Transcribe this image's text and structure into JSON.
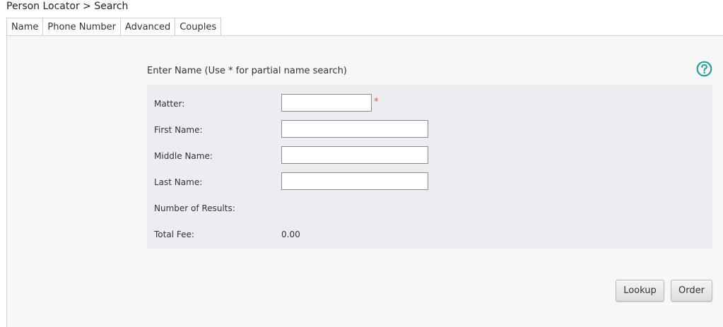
{
  "breadcrumb": "Person Locator > Search",
  "tabs": [
    {
      "label": "Name",
      "active": true
    },
    {
      "label": "Phone Number",
      "active": false
    },
    {
      "label": "Advanced",
      "active": false
    },
    {
      "label": "Couples",
      "active": false
    }
  ],
  "section": {
    "title": "Enter Name (Use * for partial name search)",
    "help_icon": "question-circle-icon"
  },
  "form": {
    "matter": {
      "label": "Matter:",
      "value": "",
      "required_marker": "*"
    },
    "first_name": {
      "label": "First Name:",
      "value": ""
    },
    "middle_name": {
      "label": "Middle Name:",
      "value": ""
    },
    "last_name": {
      "label": "Last Name:",
      "value": ""
    },
    "number_of_results": {
      "label": "Number of Results:",
      "value": ""
    },
    "total_fee": {
      "label": "Total Fee:",
      "value": "0.00"
    }
  },
  "buttons": {
    "lookup": "Lookup",
    "order": "Order"
  },
  "colors": {
    "accent": "#2a9d9e",
    "required": "#e05050",
    "form_bg": "#ebedf0"
  }
}
